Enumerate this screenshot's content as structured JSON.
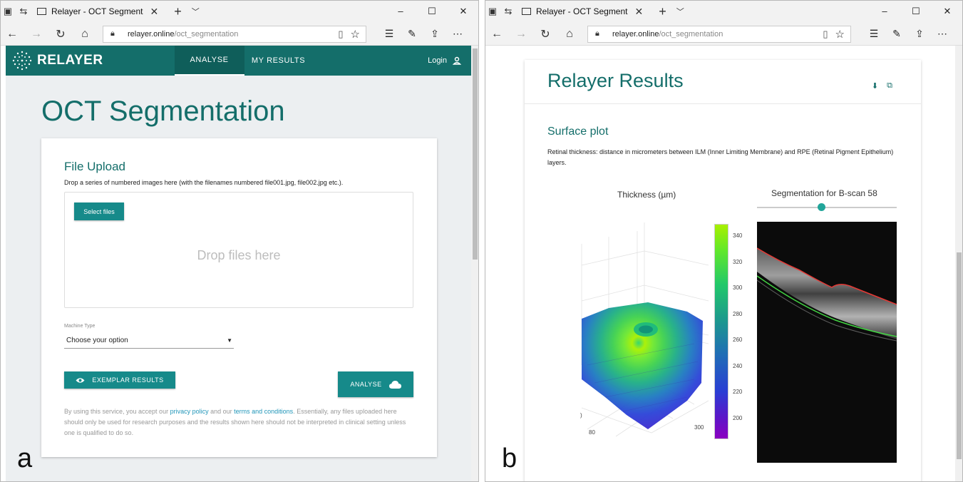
{
  "browser": {
    "tab_title": "Relayer - OCT Segment",
    "url_host": "relayer.online",
    "url_path": "/oct_segmentation"
  },
  "panel_a": {
    "label": "a",
    "brand": "RELAYER",
    "nav": {
      "analyse": "ANALYSE",
      "results": "MY RESULTS",
      "login": "Login"
    },
    "page_title": "OCT Segmentation",
    "upload": {
      "heading": "File Upload",
      "description": "Drop a series of numbered images here (with the filenames numbered file001.jpg, file002.jpg etc.).",
      "select_button": "Select files",
      "drop_text": "Drop files here"
    },
    "machine": {
      "label": "Machine Type",
      "selected": "Choose your option"
    },
    "buttons": {
      "exemplar": "EXEMPLAR RESULTS",
      "analyse": "ANALYSE"
    },
    "legal": {
      "t1": "By using this service, you accept our ",
      "privacy": "privacy policy",
      "t2": " and our ",
      "terms": "terms and conditions",
      "t3": ". Essentially, any files uploaded here should only be used for research purposes and the results shown here should not be interpreted in clinical setting unless one is qualified to do so."
    }
  },
  "panel_b": {
    "label": "b",
    "title": "Relayer Results",
    "section": "Surface plot",
    "description": "Retinal thickness: distance in micrometers between ILM (Inner Limiting Membrane) and RPE (Retinal Pigment Epithelium) layers.",
    "thickness_title": "Thickness (µm)",
    "segmentation_title": "Segmentation for B-scan 58",
    "slider_value": 0.46,
    "colorbar_ticks": [
      "340",
      "320",
      "300",
      "280",
      "260",
      "240",
      "220",
      "200"
    ],
    "axis_labels": {
      "left": "80",
      "right": "300",
      "edge": ")"
    }
  },
  "colors": {
    "brand_teal": "#146e6a",
    "button_teal": "#168a8a",
    "ilm_red": "#e53935",
    "rpe_green": "#43d443"
  }
}
